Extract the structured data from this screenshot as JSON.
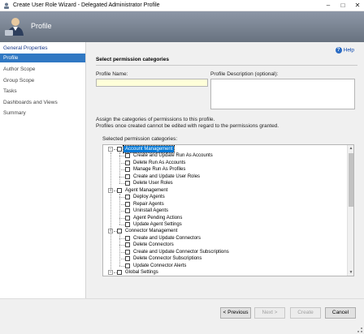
{
  "window": {
    "title": "Create User Role Wizard - Delegated Administrator Profile",
    "minimize": "–",
    "maximize": "□",
    "close": "✕"
  },
  "header": {
    "title": "Profile"
  },
  "sidebar": {
    "items": [
      {
        "label": "General Properties"
      },
      {
        "label": "Profile"
      },
      {
        "label": "Author Scope"
      },
      {
        "label": "Group Scope"
      },
      {
        "label": "Tasks"
      },
      {
        "label": "Dashboards and Views"
      },
      {
        "label": "Summary"
      }
    ]
  },
  "main": {
    "help_label": "Help",
    "section_title": "Select permission categories",
    "profile_name_label": "Profile Name:",
    "profile_name_value": "",
    "profile_desc_label": "Profile Description (optional):",
    "profile_desc_value": "",
    "assign_text": "Assign the categories of permissions to this profile.",
    "note_text": "Profiles once created cannot be edited with regard to the permissions granted.",
    "categories_label": "Selected permission categories:",
    "tree": [
      {
        "label": "Account Management",
        "level": 0,
        "expanded": true,
        "selected": true
      },
      {
        "label": "Create and Update Run As Accounts",
        "level": 1
      },
      {
        "label": "Delete Run As Accounts",
        "level": 1
      },
      {
        "label": "Manage Run As Profiles",
        "level": 1
      },
      {
        "label": "Create and Update User Roles",
        "level": 1
      },
      {
        "label": "Delete User Roles",
        "level": 1
      },
      {
        "label": "Agent Management",
        "level": 0,
        "expanded": true
      },
      {
        "label": "Deploy Agents",
        "level": 1
      },
      {
        "label": "Repair Agents",
        "level": 1
      },
      {
        "label": "Uninstall Agents",
        "level": 1
      },
      {
        "label": "Agent Pending Actions",
        "level": 1
      },
      {
        "label": "Update Agent Settings",
        "level": 1
      },
      {
        "label": "Connector Management",
        "level": 0,
        "expanded": true
      },
      {
        "label": "Create and Update Connectors",
        "level": 1
      },
      {
        "label": "Delete Connectors",
        "level": 1
      },
      {
        "label": "Create and Update Connector Subscriptions",
        "level": 1
      },
      {
        "label": "Delete Connector Subscriptions",
        "level": 1
      },
      {
        "label": "Update Connector Alerts",
        "level": 1
      },
      {
        "label": "Global Settings",
        "level": 0,
        "expanded": true
      }
    ]
  },
  "footer": {
    "previous": "< Previous",
    "next": "Next >",
    "create": "Create",
    "cancel": "Cancel"
  }
}
